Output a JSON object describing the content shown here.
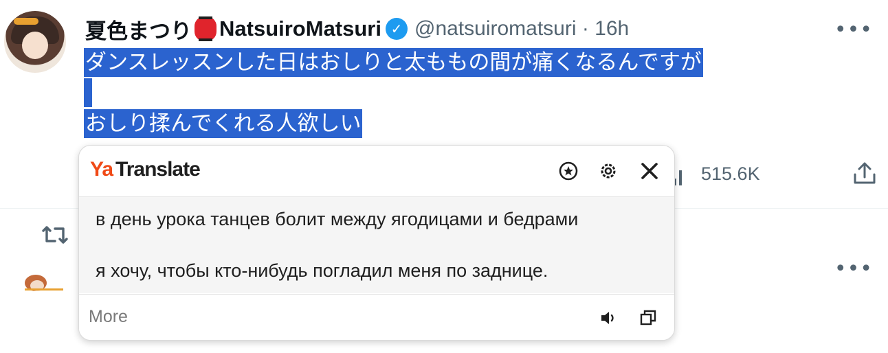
{
  "tweet": {
    "display_name": "夏色まつり",
    "display_name_suffix": "NatsuiroMatsuri",
    "handle_time": "@natsuiromatsuri · 16h",
    "lines": [
      "ダンスレッスンした日はおしりと太ももの間が痛くなるんですが",
      "",
      "おしり揉んでくれる人欲しい"
    ],
    "views": "515.6K",
    "more_glyph": "•••"
  },
  "translate_popup": {
    "brand_ya": "Ya",
    "brand_name": "Translate",
    "translation_lines": [
      "в день урока танцев болит между ягодицами и бедрами",
      "я хочу, чтобы кто-нибудь погладил меня по заднице."
    ],
    "more_label": "More"
  },
  "colors": {
    "selection": "#2b63cf",
    "verified": "#1d9bf0",
    "ya_red": "#f04a17",
    "muted": "#536471"
  },
  "icons": [
    "verified-badge-icon",
    "bookmark-star-icon",
    "gear-icon",
    "close-icon",
    "stats-icon",
    "share-icon",
    "retweet-icon",
    "speaker-icon",
    "copy-icon",
    "more-icon"
  ]
}
